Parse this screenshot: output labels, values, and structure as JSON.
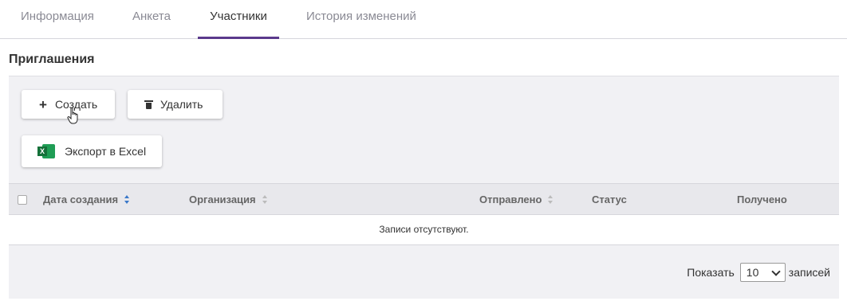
{
  "tabs": [
    {
      "label": "Информация",
      "active": false
    },
    {
      "label": "Анкета",
      "active": false
    },
    {
      "label": "Участники",
      "active": true
    },
    {
      "label": "История изменений",
      "active": false
    }
  ],
  "section": {
    "title": "Приглашения"
  },
  "toolbar": {
    "create_label": "Создать",
    "delete_label": "Удалить",
    "export_label": "Экспорт в Excel"
  },
  "table": {
    "columns": [
      {
        "label": "Дата создания",
        "sortable": true,
        "sort_active": true
      },
      {
        "label": "Организация",
        "sortable": true,
        "sort_active": false
      },
      {
        "label": "Отправлено",
        "sortable": true,
        "sort_active": false
      },
      {
        "label": "Статус",
        "sortable": false
      },
      {
        "label": "Получено",
        "sortable": false
      }
    ],
    "empty_text": "Записи отсутствуют."
  },
  "pagination": {
    "show_label": "Показать",
    "page_size": "10",
    "records_label": "записей"
  },
  "colors": {
    "accent": "#5b3a8c",
    "sort_active": "#3a78c9",
    "excel": "#1f9d55"
  }
}
